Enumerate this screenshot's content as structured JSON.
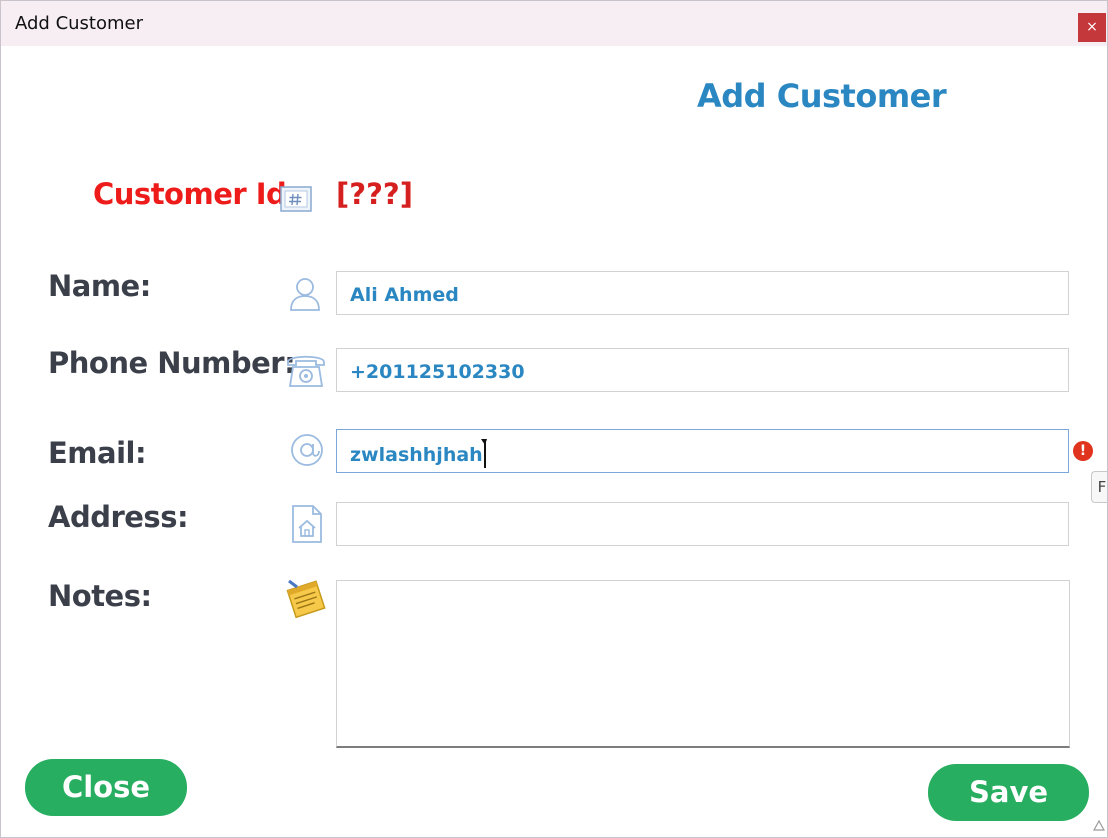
{
  "window": {
    "title": "Add Customer",
    "close_glyph": "×"
  },
  "heading": "Add Customer",
  "customer_id": {
    "label": "Customer Id:",
    "value": "[???]",
    "icon": "hash-icon"
  },
  "fields": {
    "name": {
      "label": "Name:",
      "value": "Ali Ahmed",
      "icon": "user-icon"
    },
    "phone": {
      "label": "Phone Number:",
      "value": "+201125102330",
      "icon": "telephone-icon"
    },
    "email": {
      "label": "Email:",
      "value": "zwlashhjhah",
      "icon": "at-sign-icon",
      "error_glyph": "!"
    },
    "address": {
      "label": "Address:",
      "value": "",
      "icon": "home-document-icon"
    },
    "notes": {
      "label": "Notes:",
      "value": "",
      "icon": "notepad-icon"
    }
  },
  "tooltip_partial": "F",
  "buttons": {
    "close": "Close",
    "save": "Save"
  },
  "colors": {
    "accent": "#2b87c2",
    "id_label": "#ee1b1b",
    "button": "#27ae60",
    "error": "#e0341e",
    "window_close": "#c4373b"
  }
}
